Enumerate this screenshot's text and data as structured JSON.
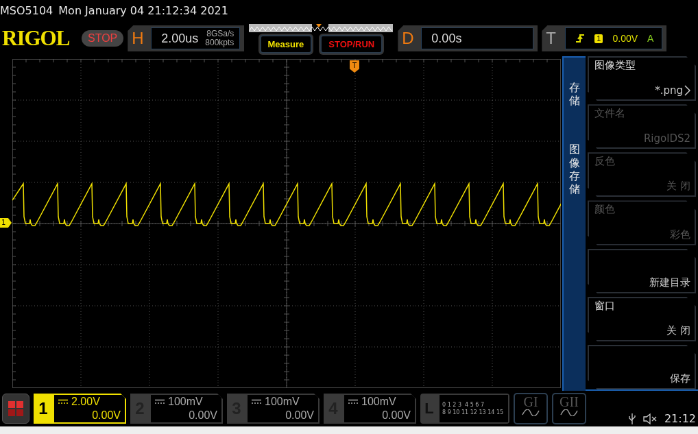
{
  "status_line": {
    "model": "MSO5104",
    "datetime": "Mon January 04 21:12:34 2021"
  },
  "header": {
    "logo": "RIGOL",
    "run_state": "STOP",
    "horizontal": {
      "label": "H",
      "timebase": "2.00us",
      "sample_rate": "8GSa/s",
      "memory_depth": "800kpts"
    },
    "measure_button": "Measure",
    "stop_run_button": "STOP/RUN",
    "delay": {
      "label": "D",
      "value": "0.00s"
    },
    "trigger": {
      "label": "T",
      "source": "1",
      "level": "0.00V",
      "mode": "A"
    }
  },
  "trigger_marker": "T",
  "channel_marker": "1",
  "side_menu": {
    "path": [
      "存储",
      "图像存储"
    ],
    "items": [
      {
        "label": "图像类型",
        "value": "*.png",
        "disabled": false,
        "submenu": true
      },
      {
        "label": "文件名",
        "value": "RigolDS2",
        "disabled": true,
        "submenu": false
      },
      {
        "label": "反色",
        "value": "关 闭",
        "disabled": true,
        "submenu": false
      },
      {
        "label": "颜色",
        "value": "彩色",
        "disabled": true,
        "submenu": false
      },
      {
        "value": "新建目录",
        "disabled": false,
        "submenu": false
      },
      {
        "label": "窗口",
        "value": "关 闭",
        "disabled": false,
        "submenu": false
      },
      {
        "value": "保存",
        "disabled": false,
        "submenu": false
      }
    ]
  },
  "channels": [
    {
      "number": "1",
      "scale": "2.00V",
      "offset": "0.00V",
      "active": true
    },
    {
      "number": "2",
      "scale": "100mV",
      "offset": "0.00V",
      "active": false
    },
    {
      "number": "3",
      "scale": "100mV",
      "offset": "0.00V",
      "active": false
    },
    {
      "number": "4",
      "scale": "100mV",
      "offset": "0.00V",
      "active": false
    }
  ],
  "logic_analyzer": {
    "label": "L",
    "rows": [
      "0 1 2 3  4 5 6 7",
      "8 9 10 11 12 13 14 15"
    ]
  },
  "generators": [
    "GI",
    "GII"
  ],
  "clock": "21:12"
}
